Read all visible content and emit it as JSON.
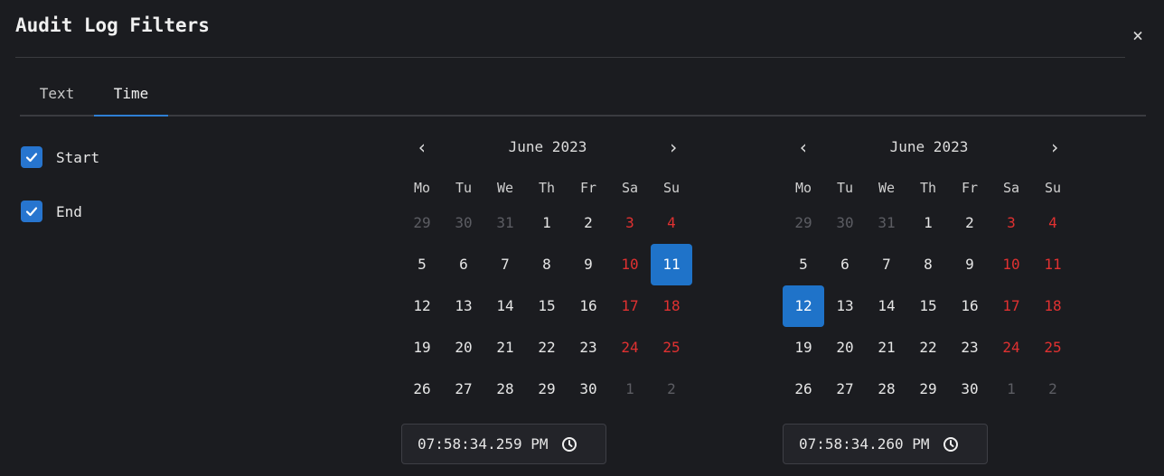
{
  "dialog": {
    "title": "Audit Log Filters",
    "close_glyph": "×"
  },
  "tabs": [
    {
      "label": "Text",
      "active": false
    },
    {
      "label": "Time",
      "active": true
    }
  ],
  "filters": {
    "start": {
      "label": "Start",
      "checked": true
    },
    "end": {
      "label": "End",
      "checked": true
    }
  },
  "weekdays": [
    "Mo",
    "Tu",
    "We",
    "Th",
    "Fr",
    "Sa",
    "Su"
  ],
  "calendars": [
    {
      "month_label": "June 2023",
      "prev_glyph": "‹",
      "next_glyph": "›",
      "selected": "11",
      "weeks": [
        [
          "29",
          "30",
          "31",
          "1",
          "2",
          "3",
          "4"
        ],
        [
          "5",
          "6",
          "7",
          "8",
          "9",
          "10",
          "11"
        ],
        [
          "12",
          "13",
          "14",
          "15",
          "16",
          "17",
          "18"
        ],
        [
          "19",
          "20",
          "21",
          "22",
          "23",
          "24",
          "25"
        ],
        [
          "26",
          "27",
          "28",
          "29",
          "30",
          "1",
          "2"
        ]
      ],
      "time": "07:58:34.259 PM"
    },
    {
      "month_label": "June 2023",
      "prev_glyph": "‹",
      "next_glyph": "›",
      "selected": "12",
      "weeks": [
        [
          "29",
          "30",
          "31",
          "1",
          "2",
          "3",
          "4"
        ],
        [
          "5",
          "6",
          "7",
          "8",
          "9",
          "10",
          "11"
        ],
        [
          "12",
          "13",
          "14",
          "15",
          "16",
          "17",
          "18"
        ],
        [
          "19",
          "20",
          "21",
          "22",
          "23",
          "24",
          "25"
        ],
        [
          "26",
          "27",
          "28",
          "29",
          "30",
          "1",
          "2"
        ]
      ],
      "time": "07:58:34.260 PM"
    }
  ],
  "icons": {
    "close": "close-icon",
    "checkbox": "check-icon",
    "clock": "clock-icon"
  },
  "colors": {
    "accent": "#1f73c9",
    "weekend": "#e03131",
    "outside": "#5c5d63",
    "background": "#1b1c20"
  }
}
